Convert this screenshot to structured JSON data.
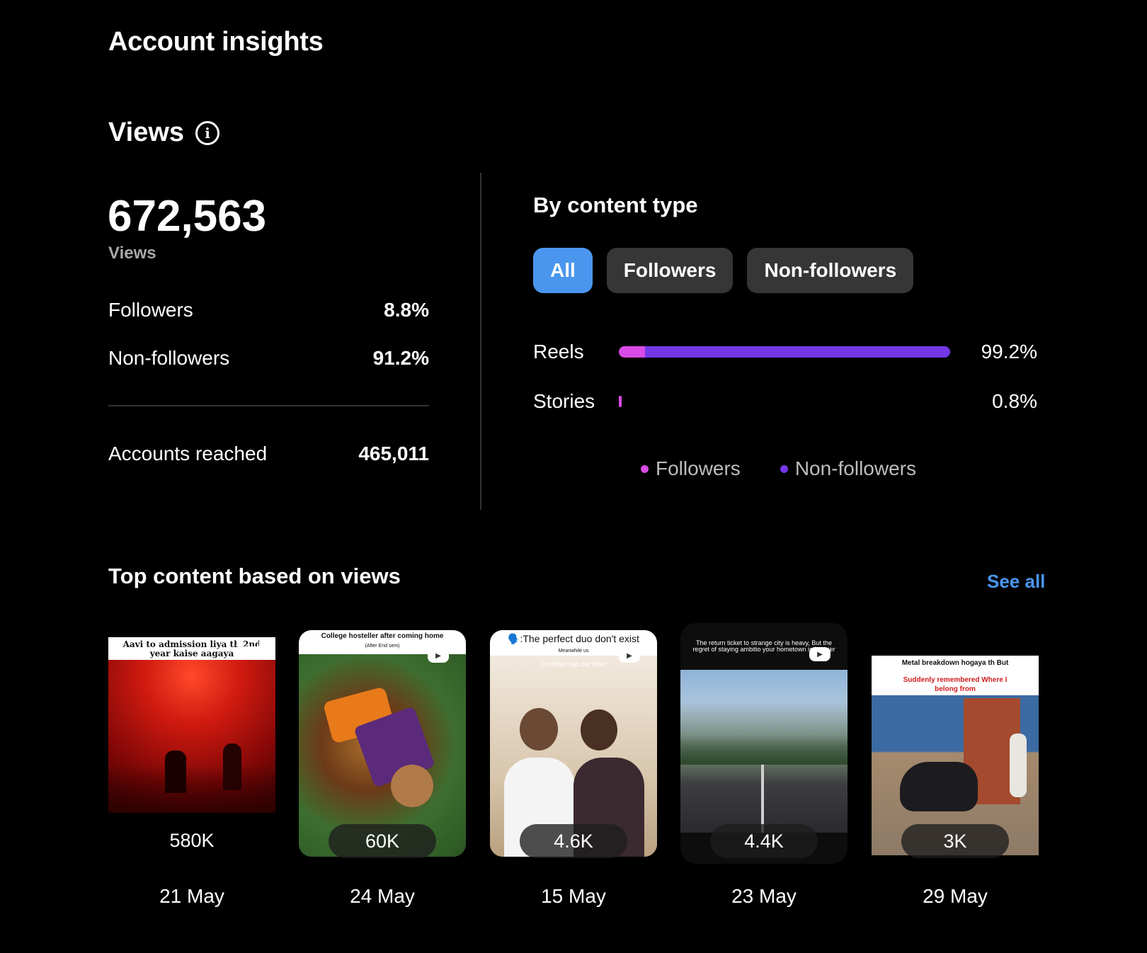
{
  "page": {
    "title": "Account insights"
  },
  "views": {
    "heading": "Views",
    "total": "672,563",
    "total_label": "Views",
    "followers_label": "Followers",
    "followers_pct": "8.8%",
    "non_followers_label": "Non-followers",
    "non_followers_pct": "91.2%",
    "accounts_reached_label": "Accounts reached",
    "accounts_reached": "465,011"
  },
  "by_content_type": {
    "heading": "By content type",
    "tabs": [
      "All",
      "Followers",
      "Non-followers"
    ],
    "active_tab": "All",
    "rows": [
      {
        "label": "Reels",
        "pct": "99.2%",
        "fraction": 0.992,
        "followers_share": 0.08
      },
      {
        "label": "Stories",
        "pct": "0.8%",
        "fraction": 0.008,
        "followers_share": 1.0
      }
    ],
    "legend": [
      {
        "label": "Followers",
        "color": "#d94be6"
      },
      {
        "label": "Non-followers",
        "color": "#7238e8"
      }
    ]
  },
  "top_content": {
    "heading": "Top content based on views",
    "see_all": "See all",
    "items": [
      {
        "views": "580K",
        "date": "21 May",
        "caption": "Aavi to admission liya th 2nd year kaise aagaya"
      },
      {
        "views": "60K",
        "date": "24 May",
        "caption": "College hosteller after coming home",
        "subcaption": "(After End sem)"
      },
      {
        "views": "4.6K",
        "date": "15 May",
        "caption": "🗣️:The perfect duo don't exist",
        "subcaption": "Meanwhile us",
        "overlay": "Do Bihari sab par bhari"
      },
      {
        "views": "4.4K",
        "date": "23 May",
        "caption": "The return ticket to strange city is heavy, But the regret of staying ambitio your hometown is heavier"
      },
      {
        "views": "3K",
        "date": "29 May",
        "caption": "Metal breakdown hogaya th But",
        "subcaption": "Suddenly remembered Where I belong from"
      }
    ]
  }
}
